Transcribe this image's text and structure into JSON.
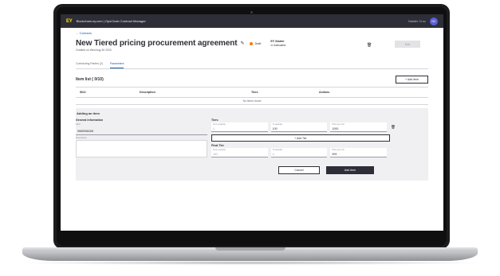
{
  "header": {
    "logo": "EY",
    "app_title": "Blockchain.ey.com | OpsChain Contract Manager",
    "user_name": "Natalie Cruz",
    "avatar_initials": "NC"
  },
  "back_link": "← Contracts",
  "contract": {
    "title": "New Tiered pricing procurement agreement",
    "status": "Draft",
    "status_color": "#ff7a00",
    "created": "Created on Wed Aug 30 2023",
    "org_name": "EY Starter",
    "org_status": "⊙ Activated",
    "top_button": "Edit"
  },
  "tabs": [
    {
      "label": "Contracting Parties (2)"
    },
    {
      "label": "Parameters"
    }
  ],
  "item_list": {
    "title": "Item list ( 0/10)",
    "add_button": "+ Add item",
    "columns": [
      "SKU",
      "Description",
      "Tiers",
      "Actions"
    ],
    "empty_text": "No items found"
  },
  "adding": {
    "title": "Adding an item",
    "general_title": "General information",
    "sku_label": "SKU",
    "sku_value": "9685956268",
    "description_label": "Description",
    "tiers_title": "Tiers",
    "tier": {
      "from_label": "From quantity",
      "from_value": "1",
      "to_label": "To quantity",
      "to_value": "100",
      "price_label": "Price per unit",
      "price_value": "1000"
    },
    "add_tier_button": "+ Add Tier",
    "final_title": "Final Tier",
    "final_tier": {
      "from_label": "From quantity",
      "from_value": "101",
      "to_label": "To quantity",
      "to_value": "∞",
      "price_label": "Price per unit",
      "price_value": "999"
    },
    "cancel_button": "Cancel",
    "submit_button": "Add item"
  },
  "colors": {
    "header_bg": "#2e2e38",
    "brand_yellow": "#ffe600",
    "link_blue": "#155cb4"
  }
}
